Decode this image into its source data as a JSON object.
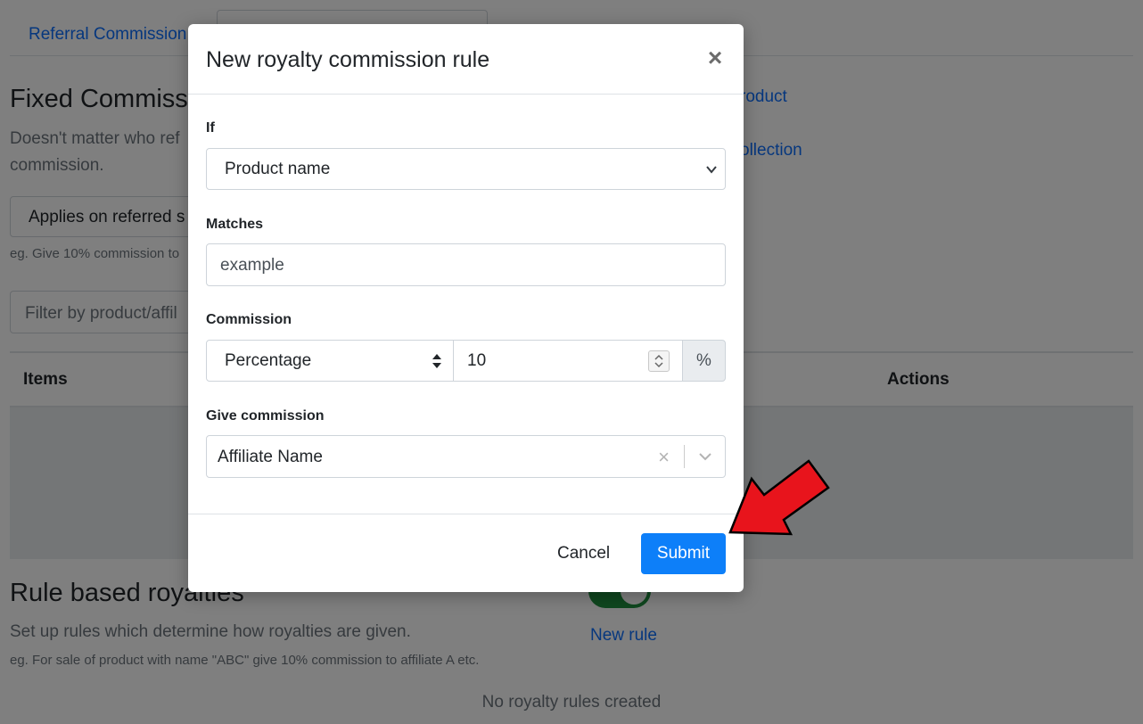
{
  "background": {
    "tab_label": "Referral Commission",
    "fixed_heading": "Fixed Commiss",
    "fixed_desc_line1": "Doesn't matter who ref",
    "fixed_desc_line2": "commission.",
    "applies_select": "Applies on referred s",
    "example_hint": "eg. Give 10% commission to",
    "filter_placeholder": "Filter by product/affil",
    "link_product": "roduct",
    "link_collection": "ollection",
    "table_headers": {
      "items": "Items",
      "actions": "Actions"
    },
    "rule_heading": "Rule based royalties",
    "rule_desc": "Set up rules which determine how royalties are given.",
    "rule_hint": "eg. For sale of product with name \"ABC\" give 10% commission to affiliate A etc.",
    "new_rule_link": "New rule",
    "empty_text": "No royalty rules created",
    "toggle_on": true
  },
  "modal": {
    "title": "New royalty commission rule",
    "close_glyph": "×",
    "fields": {
      "if_label": "If",
      "if_value": "Product name",
      "matches_label": "Matches",
      "matches_value": "example",
      "commission_label": "Commission",
      "commission_type": "Percentage",
      "commission_value": "10",
      "commission_unit": "%",
      "give_label": "Give commission",
      "give_value": "Affiliate Name",
      "clear_glyph": "×"
    },
    "footer": {
      "cancel": "Cancel",
      "submit": "Submit"
    }
  },
  "colors": {
    "primary": "#0d7ff9",
    "annotation_arrow": "#e8141c",
    "toggle_on": "#1e8e3e"
  }
}
